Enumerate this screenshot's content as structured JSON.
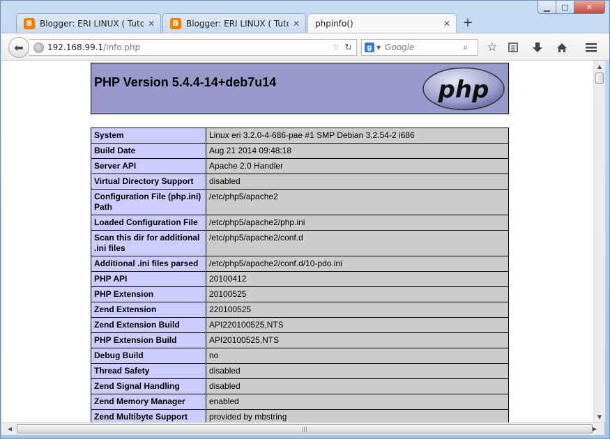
{
  "window": {
    "minimize_glyph": "▁",
    "maximize_glyph": "□",
    "close_glyph": "✕"
  },
  "tabs": [
    {
      "label": "Blogger: ERI LINUX ( Tutori...",
      "icon": "blogger-icon",
      "active": false
    },
    {
      "label": "Blogger: ERI LINUX ( Tutori...",
      "icon": "blogger-icon",
      "active": false
    },
    {
      "label": "phpinfo()",
      "icon": "",
      "active": true
    }
  ],
  "navbar": {
    "url_host": "192.168.99.1",
    "url_path": "/info.php",
    "search_placeholder": "Google"
  },
  "page": {
    "title": "PHP Version 5.4.4-14+deb7u14",
    "rows": [
      {
        "key": "System",
        "value": "Linux eri 3.2.0-4-686-pae #1 SMP Debian 3.2.54-2 i686"
      },
      {
        "key": "Build Date",
        "value": "Aug 21 2014 09:48:18"
      },
      {
        "key": "Server API",
        "value": "Apache 2.0 Handler"
      },
      {
        "key": "Virtual Directory Support",
        "value": "disabled"
      },
      {
        "key": "Configuration File (php.ini) Path",
        "value": "/etc/php5/apache2"
      },
      {
        "key": "Loaded Configuration File",
        "value": "/etc/php5/apache2/php.ini"
      },
      {
        "key": "Scan this dir for additional .ini files",
        "value": "/etc/php5/apache2/conf.d"
      },
      {
        "key": "Additional .ini files parsed",
        "value": "/etc/php5/apache2/conf.d/10-pdo.ini"
      },
      {
        "key": "PHP API",
        "value": "20100412"
      },
      {
        "key": "PHP Extension",
        "value": "20100525"
      },
      {
        "key": "Zend Extension",
        "value": "220100525"
      },
      {
        "key": "Zend Extension Build",
        "value": "API220100525,NTS"
      },
      {
        "key": "PHP Extension Build",
        "value": "API20100525,NTS"
      },
      {
        "key": "Debug Build",
        "value": "no"
      },
      {
        "key": "Thread Safety",
        "value": "disabled"
      },
      {
        "key": "Zend Signal Handling",
        "value": "disabled"
      },
      {
        "key": "Zend Memory Manager",
        "value": "enabled"
      },
      {
        "key": "Zend Multibyte Support",
        "value": "provided by mbstring"
      }
    ]
  },
  "colors": {
    "header_bg": "#9999cc",
    "key_bg": "#ccccff",
    "value_bg": "#cccccc"
  }
}
